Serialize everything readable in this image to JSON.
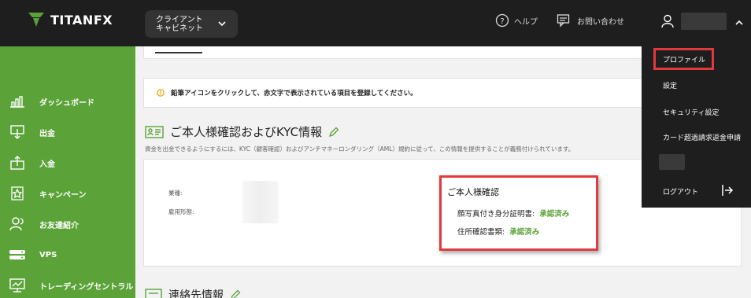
{
  "header": {
    "logo_text": "TITANFX",
    "cabinet_label": "クライアント キャビネット",
    "help_label": "ヘルプ",
    "contact_label": "お問い合わせ"
  },
  "sidebar": {
    "items": [
      {
        "label": "ダッシュボード",
        "icon": "bar-chart-icon"
      },
      {
        "label": "出金",
        "icon": "withdraw-icon"
      },
      {
        "label": "入金",
        "icon": "deposit-icon"
      },
      {
        "label": "キャンペーン",
        "icon": "star-badge-icon"
      },
      {
        "label": "お友達紹介",
        "icon": "people-icon"
      },
      {
        "label": "VPS",
        "icon": "server-icon"
      },
      {
        "label": "トレーディングセントラル",
        "icon": "monitor-icon"
      }
    ]
  },
  "notice": {
    "text": "鉛筆アイコンをクリックして、赤文字で表示されている項目を登録してください。"
  },
  "kyc": {
    "title": "ご本人様確認およびKYC情報",
    "description": "資金を出金できるようにするには、KYC（顧客確認）およびアンチマネーロンダリング（AML）規約に従って、この情報を提供することが義務付けられています。",
    "fields": [
      {
        "label": "業種:"
      },
      {
        "label": "雇用形態:"
      }
    ],
    "verification": {
      "title": "ご本人様確認",
      "rows": [
        {
          "key": "顔写真付き身分証明書:",
          "status": "承認済み"
        },
        {
          "key": "住所確認書類:",
          "status": "承認済み"
        }
      ]
    }
  },
  "contact_section": {
    "title": "連絡先情報"
  },
  "dropdown": {
    "items": [
      {
        "label": "プロファイル"
      },
      {
        "label": "設定"
      },
      {
        "label": "セキュリティ設定"
      },
      {
        "label": "カード超過請求返金申請"
      }
    ],
    "logout_label": "ログアウト"
  },
  "colors": {
    "brand_green": "#5ba339",
    "topbar": "#1e1e1e",
    "highlight_red": "#e03a3e",
    "status_green": "#5ba339"
  }
}
